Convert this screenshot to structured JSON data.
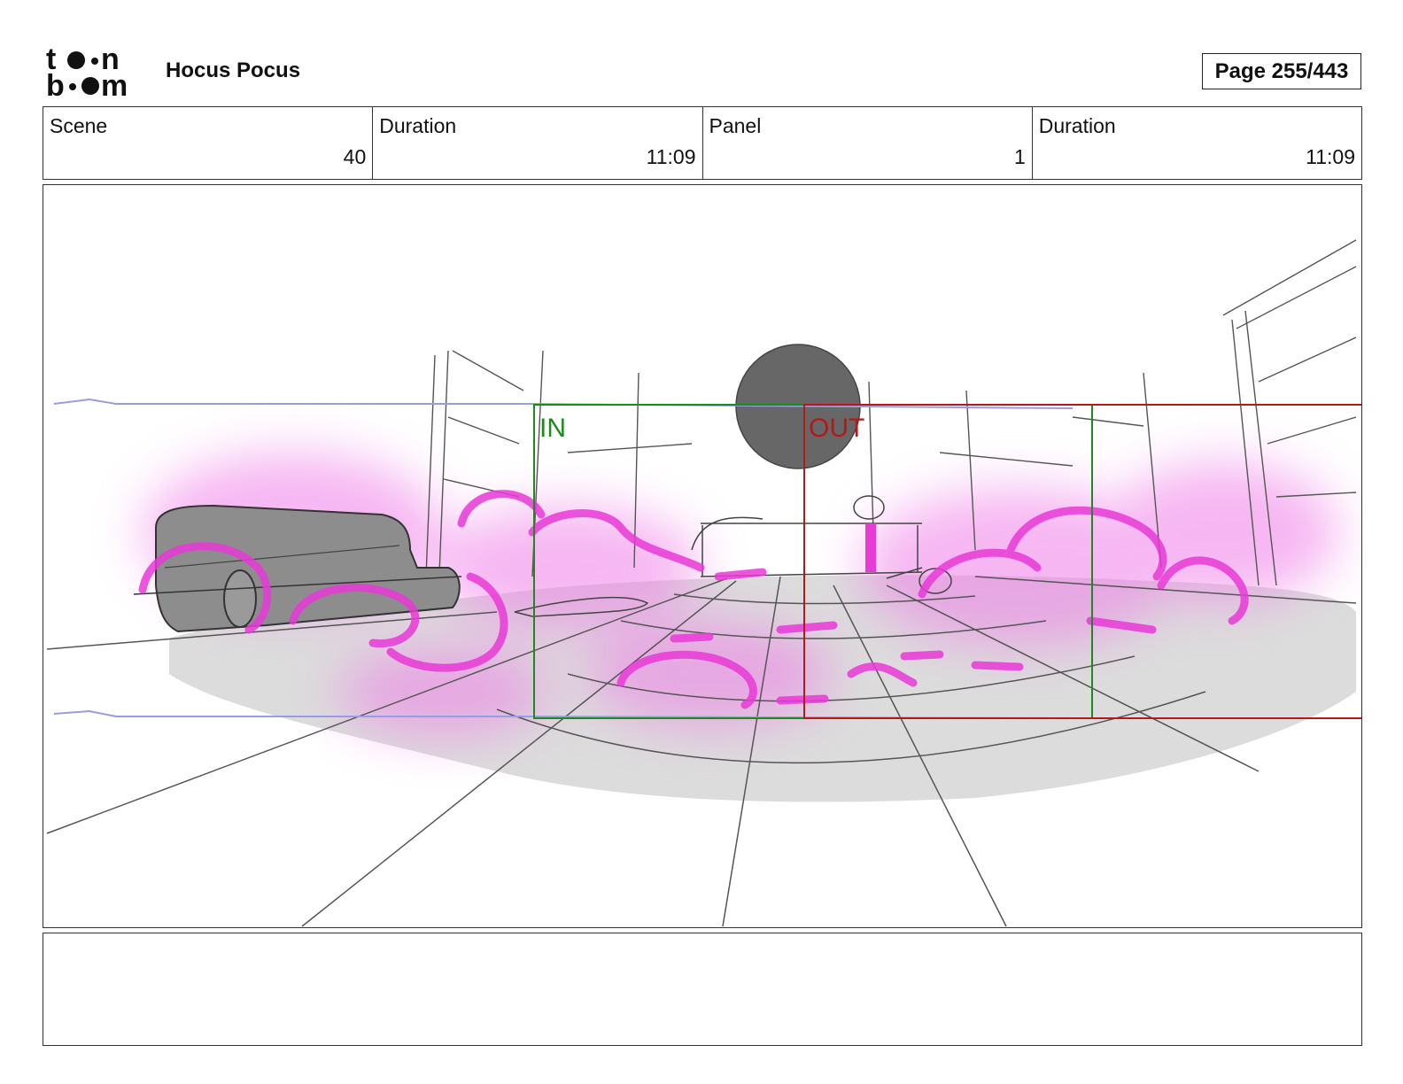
{
  "header": {
    "logo_text": "toon boom",
    "project_title": "Hocus Pocus",
    "page_label": "Page 255/443"
  },
  "info": {
    "scene_label": "Scene",
    "scene_value": "40",
    "scene_duration_label": "Duration",
    "scene_duration_value": "11:09",
    "panel_label": "Panel",
    "panel_value": "1",
    "panel_duration_label": "Duration",
    "panel_duration_value": "11:09"
  },
  "panel": {
    "camera_in_label": "IN",
    "camera_out_label": "OUT",
    "colors": {
      "in_frame": "#1e8a1e",
      "out_frame": "#b01a1a",
      "magic": "#e83ad6",
      "sketch": "#444444",
      "fill_gray": "#888888",
      "floor_shadow": "#d9d9d9",
      "guide_blue": "#9b9be0"
    }
  },
  "notes": {
    "text": ""
  }
}
